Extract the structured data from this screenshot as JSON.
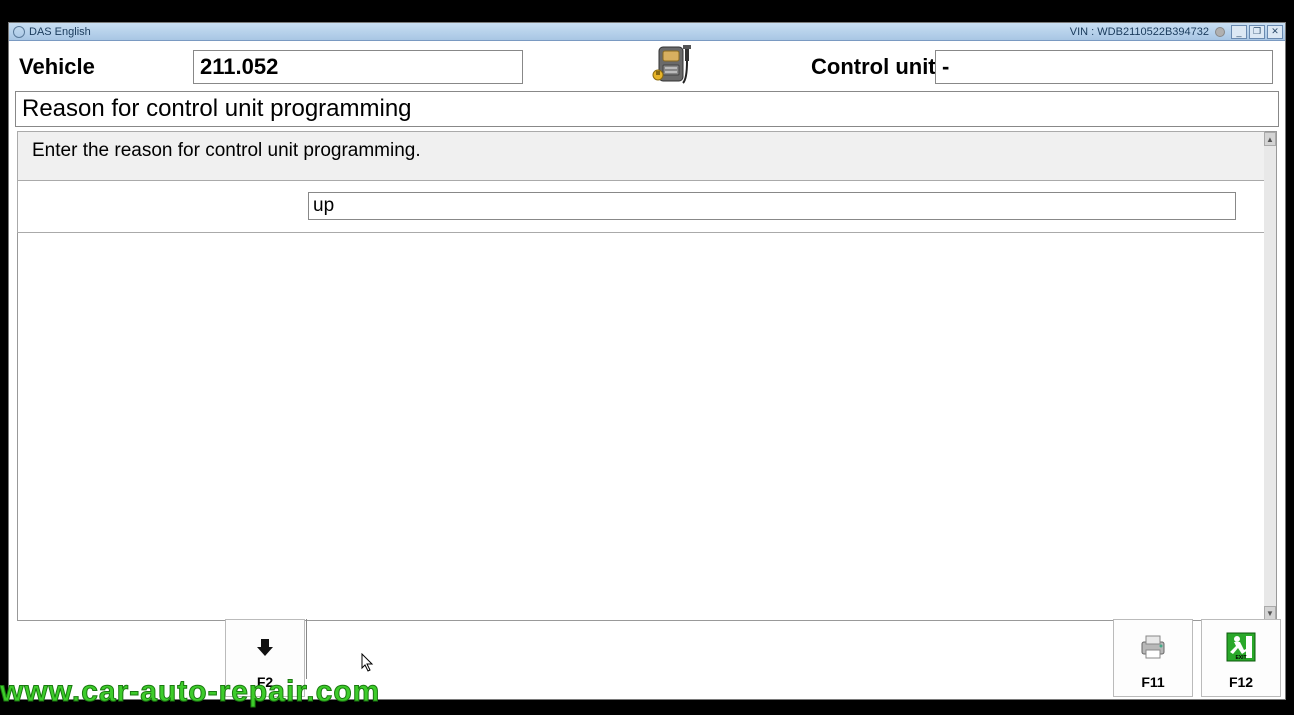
{
  "window": {
    "title": "DAS English",
    "vin_label": "VIN : WDB2110522B394732"
  },
  "header": {
    "vehicle_label": "Vehicle",
    "vehicle_value": "211.052",
    "control_unit_label": "Control unit",
    "control_unit_value": "-"
  },
  "page": {
    "title": "Reason for control unit programming",
    "instruction": "Enter the reason for control unit programming.",
    "reason_input_value": "up"
  },
  "footer": {
    "f2": "F2",
    "f11": "F11",
    "f12": "F12"
  },
  "watermark": "www.car-auto-repair.com"
}
